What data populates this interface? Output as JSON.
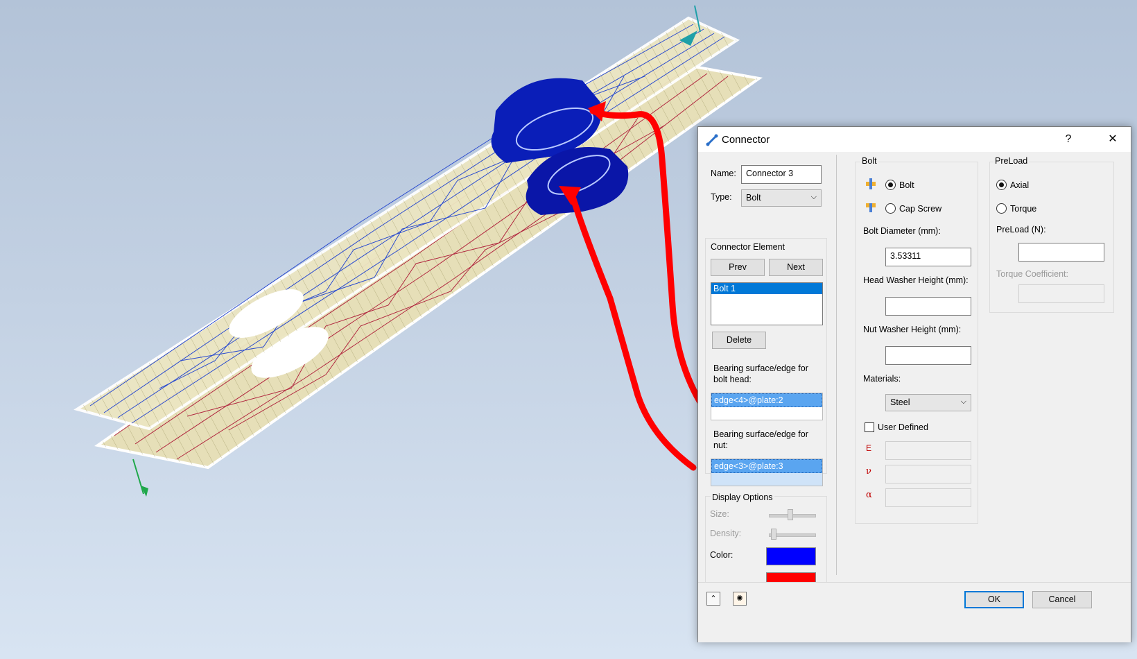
{
  "colors": {
    "accent": "#0078d7",
    "bolt_color": "#0000ff",
    "nut_color": "#ff0000",
    "annotation": "#ff0000"
  },
  "dialog": {
    "title": "Connector",
    "help_label": "?",
    "close_label": "✕",
    "name_label": "Name:",
    "name_value": "Connector 3",
    "type_label": "Type:",
    "type_value": "Bolt",
    "connector_element": {
      "legend": "Connector Element",
      "prev_label": "Prev",
      "next_label": "Next",
      "items": [
        "Bolt 1"
      ],
      "delete_label": "Delete",
      "head_label_line1": "Bearing surface/edge for",
      "head_label_line2": "bolt head:",
      "head_value": "edge<4>@plate:2",
      "nut_label_line1": "Bearing surface/edge for",
      "nut_label_line2": "nut:",
      "nut_value": "edge<3>@plate:3"
    },
    "display_options": {
      "legend": "Display Options",
      "size_label": "Size:",
      "density_label": "Density:",
      "color_label": "Color:"
    },
    "bolt": {
      "legend": "Bolt",
      "option_bolt": "Bolt",
      "option_cap_screw": "Cap Screw",
      "selected": "Bolt",
      "diameter_label": "Bolt Diameter (mm):",
      "diameter_value": "3.53311",
      "head_washer_label": "Head Washer Height (mm):",
      "head_washer_value": "",
      "nut_washer_label": "Nut Washer Height (mm):",
      "nut_washer_value": "",
      "materials_label": "Materials:",
      "material_value": "Steel",
      "user_defined_label": "User Defined",
      "prop_e": "E",
      "prop_nu": "ν",
      "prop_alpha": "α"
    },
    "preload": {
      "legend": "PreLoad",
      "option_axial": "Axial",
      "option_torque": "Torque",
      "selected": "Axial",
      "preload_label": "PreLoad (N):",
      "preload_value": "",
      "torque_coef_label": "Torque Coefficient:"
    },
    "ok_label": "OK",
    "cancel_label": "Cancel"
  }
}
